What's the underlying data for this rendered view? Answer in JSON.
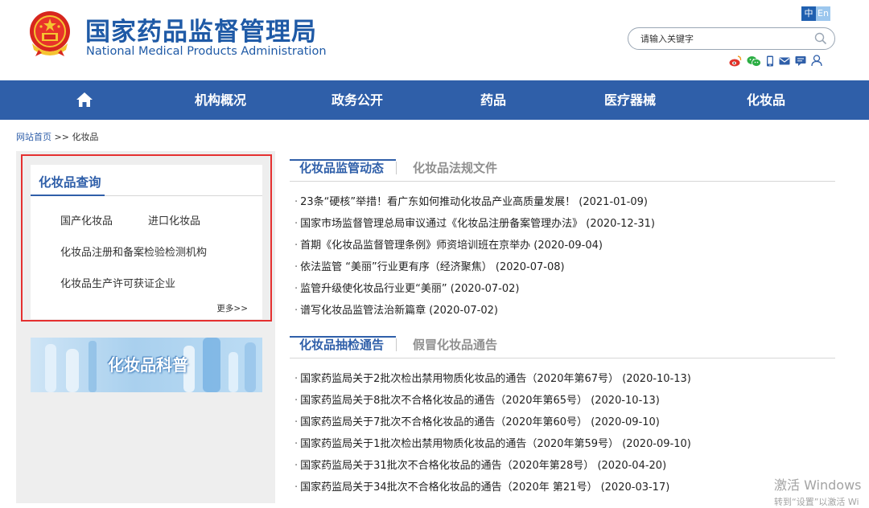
{
  "header": {
    "title_cn": "国家药品监督管理局",
    "title_en": "National Medical Products Administration",
    "lang_zh": "中",
    "lang_en": "En",
    "search_placeholder": "请输入关键字",
    "social_icons": [
      "weibo-icon",
      "wechat-icon",
      "mobile-icon",
      "mail-icon",
      "message-icon",
      "user-icon"
    ]
  },
  "nav": {
    "items": [
      "机构概况",
      "政务公开",
      "药品",
      "医疗器械",
      "化妆品"
    ],
    "home_icon": "home-icon"
  },
  "breadcrumb": {
    "home": "网站首页",
    "sep": ">>",
    "current": "化妆品"
  },
  "sidebar": {
    "query_title": "化妆品查询",
    "links": [
      "国产化妆品",
      "进口化妆品",
      "化妆品注册和备案检验检测机构",
      "化妆品生产许可获证企业"
    ],
    "more": "更多>>",
    "banner_text": "化妆品科普"
  },
  "section1": {
    "tabs": [
      "化妆品监管动态",
      "化妆品法规文件"
    ],
    "items": [
      {
        "title": "23条“硬核”举措！看广东如何推动化妆品产业高质量发展！",
        "date": "(2021-01-09)"
      },
      {
        "title": "国家市场监督管理总局审议通过《化妆品注册备案管理办法》",
        "date": "(2020-12-31)"
      },
      {
        "title": "首期《化妆品监督管理条例》师资培训班在京举办",
        "date": "(2020-09-04)"
      },
      {
        "title": "依法监管 “美丽”行业更有序（经济聚焦）",
        "date": "(2020-07-08)"
      },
      {
        "title": "监管升级使化妆品行业更“美丽”",
        "date": "(2020-07-02)"
      },
      {
        "title": "谱写化妆品监管法治新篇章",
        "date": "(2020-07-02)"
      }
    ]
  },
  "section2": {
    "tabs": [
      "化妆品抽检通告",
      "假冒化妆品通告"
    ],
    "items": [
      {
        "title": "国家药监局关于2批次检出禁用物质化妆品的通告（2020年第67号）",
        "date": "(2020-10-13)"
      },
      {
        "title": "国家药监局关于8批次不合格化妆品的通告（2020年第65号）",
        "date": "(2020-10-13)"
      },
      {
        "title": "国家药监局关于7批次不合格化妆品的通告（2020年第60号）",
        "date": "(2020-09-10)"
      },
      {
        "title": "国家药监局关于1批次检出禁用物质化妆品的通告（2020年第59号）",
        "date": "(2020-09-10)"
      },
      {
        "title": "国家药监局关于31批次不合格化妆品的通告（2020年第28号）",
        "date": "(2020-04-20)"
      },
      {
        "title": "国家药监局关于34批次不合格化妆品的通告（2020年 第21号）",
        "date": "(2020-03-17)"
      }
    ]
  },
  "watermark": {
    "line1": "激活 Windows",
    "line2": "转到“设置”以激活 Wi"
  },
  "colors": {
    "brand_blue": "#2f5fa9",
    "highlight_red": "#e53030",
    "sidebar_bg": "#eeeeee"
  }
}
